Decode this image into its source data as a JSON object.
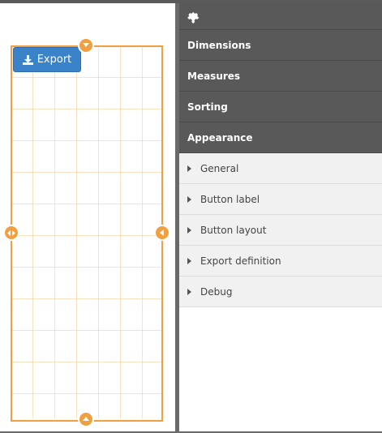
{
  "canvas": {
    "export_button": {
      "label": "Export",
      "icon": "download-icon"
    }
  },
  "panel": {
    "header_icon": "puzzle-icon",
    "sections": [
      {
        "label": "Dimensions"
      },
      {
        "label": "Measures"
      },
      {
        "label": "Sorting"
      },
      {
        "label": "Appearance"
      }
    ],
    "appearance_items": [
      {
        "label": "General"
      },
      {
        "label": "Button label"
      },
      {
        "label": "Button layout"
      },
      {
        "label": "Export definition"
      },
      {
        "label": "Debug"
      }
    ]
  },
  "colors": {
    "accent": "#f0a040",
    "button": "#3b83c8",
    "panel_dark": "#595959",
    "panel_light": "#f1f1f1"
  }
}
